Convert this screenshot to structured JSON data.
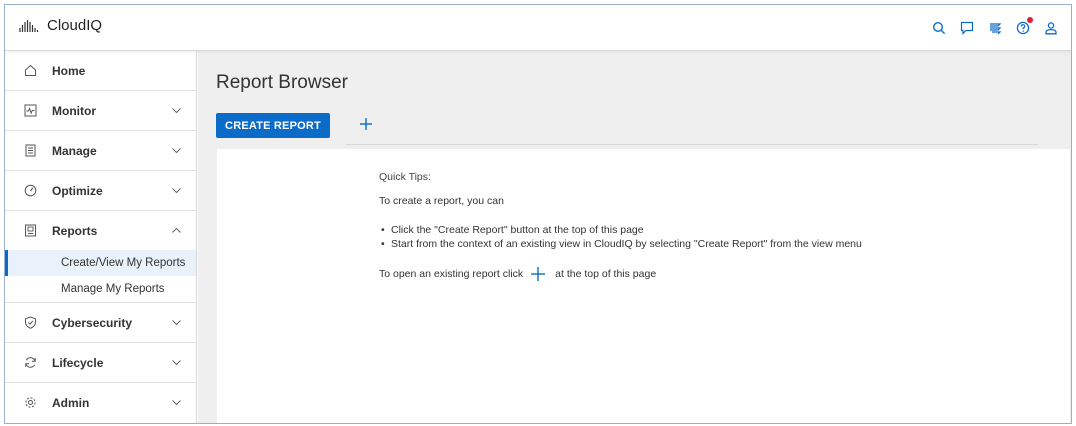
{
  "app": {
    "name": "CloudIQ"
  },
  "colors": {
    "accent": "#0a6cc8",
    "notification": "#e0202f"
  },
  "topbar": {
    "icons": [
      "search-icon",
      "feedback-icon",
      "stacks-icon",
      "help-icon",
      "user-icon"
    ]
  },
  "sidebar": {
    "items": [
      {
        "label": "Home",
        "icon": "home-icon"
      },
      {
        "label": "Monitor",
        "icon": "monitor-icon"
      },
      {
        "label": "Manage",
        "icon": "manage-icon"
      },
      {
        "label": "Optimize",
        "icon": "optimize-icon"
      },
      {
        "label": "Reports",
        "icon": "reports-icon",
        "expanded": true,
        "children": [
          {
            "label": "Create/View My Reports",
            "active": true
          },
          {
            "label": "Manage My Reports"
          }
        ]
      },
      {
        "label": "Cybersecurity",
        "icon": "shield-icon"
      },
      {
        "label": "Lifecycle",
        "icon": "lifecycle-icon"
      },
      {
        "label": "Admin",
        "icon": "gear-icon"
      }
    ]
  },
  "main": {
    "title": "Report Browser",
    "create_button": "CREATE REPORT",
    "tips": {
      "heading": "Quick Tips:",
      "intro": "To create a report, you can",
      "bullets": [
        "Click the \"Create Report\" button at the top of this page",
        "Start from the context of an existing view in CloudIQ by selecting \"Create Report\" from the view menu"
      ],
      "open_prefix": "To open an existing report click",
      "open_suffix": "at the top of this page"
    }
  }
}
